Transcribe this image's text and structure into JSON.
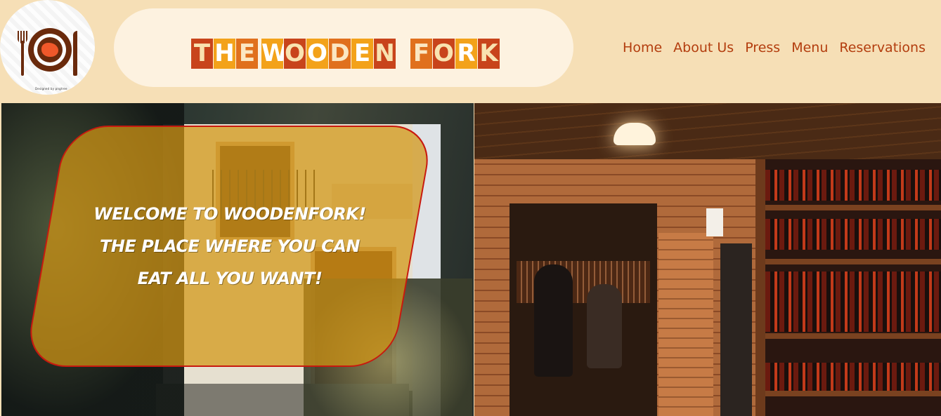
{
  "brand": {
    "title_words": [
      "THE",
      "WOODEN",
      "FORK"
    ],
    "logo_credit": "Designed by pngtree"
  },
  "nav": {
    "items": [
      {
        "label": "Home"
      },
      {
        "label": "About Us"
      },
      {
        "label": "Press"
      },
      {
        "label": "Menu"
      },
      {
        "label": "Reservations"
      }
    ]
  },
  "hero": {
    "welcome_lines": [
      "WELCOME TO WOODENFORK!",
      "THE PLACE WHERE YOU CAN",
      "EAT ALL YOU WANT!"
    ]
  },
  "colors": {
    "header_bg": "#f6dfb6",
    "nav_link": "#b33d0e",
    "card_border": "#c8190f"
  },
  "icons": {
    "logo": "plate-fork-knife-icon"
  }
}
